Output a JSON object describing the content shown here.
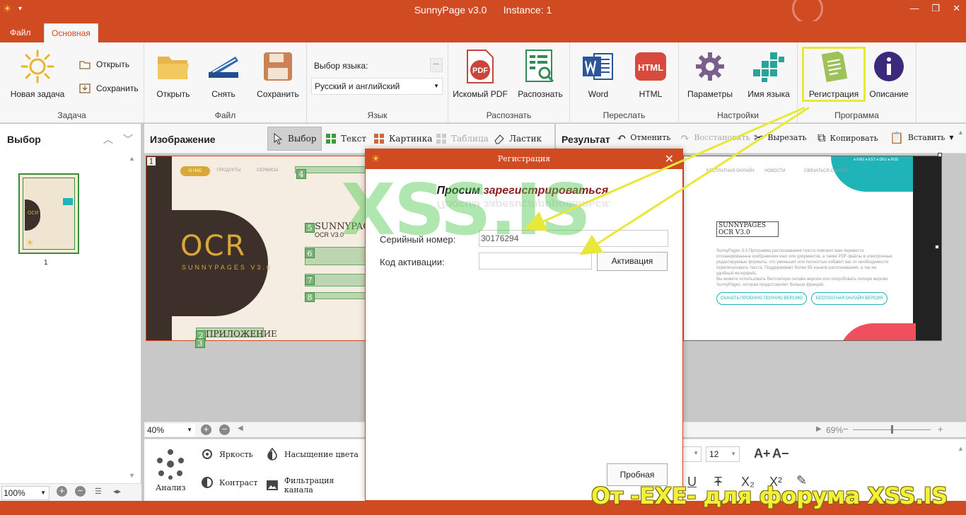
{
  "window": {
    "title": "SunnyPage v3.0      Instance: 1",
    "minimize": "—",
    "maximize": "❐",
    "close": "✕"
  },
  "tabs": {
    "file": "Файл",
    "main": "Основная"
  },
  "ribbon": {
    "task": {
      "new_task": "Новая задача",
      "open": "Открыть",
      "save": "Сохранить",
      "label": "Задача"
    },
    "file": {
      "open": "Открыть",
      "scan": "Снять",
      "save": "Сохранить",
      "label": "Файл"
    },
    "language": {
      "select_label": "Выбор языка:",
      "selected": "Русский и английский",
      "dots": "...",
      "label": "Язык"
    },
    "recognize": {
      "pdf": "Искомый PDF",
      "recognize": "Распознать",
      "label": "Распознать",
      "pdf_icon_text": "PDF"
    },
    "send": {
      "word": "Word",
      "html": "HTML",
      "label": "Переслать",
      "html_icon_text": "HTML"
    },
    "settings": {
      "params": "Параметры",
      "lang_name": "Имя языка",
      "label": "Настройки"
    },
    "program": {
      "register": "Регистрация",
      "about": "Описание",
      "label": "Программа"
    }
  },
  "left_panel": {
    "title": "Выбор",
    "page_number": "1",
    "zoom": "100%"
  },
  "image_panel": {
    "title": "Изображение",
    "tools": {
      "select": "Выбор",
      "text": "Текст",
      "picture": "Картинка",
      "table": "Таблица",
      "eraser": "Ластик"
    },
    "zoom": "40%",
    "page": {
      "nav": [
        "О НАС",
        "ПРОДУКТЫ",
        "СЕРВИСЫ"
      ],
      "ocr": "OCR",
      "ocr_sub": "SUNNYPAGES V3.0",
      "sunny_head": "SUNNYPAGES",
      "ocr_version": "OCR V3.0",
      "app_label": "ПРИЛОЖЕНИЕ",
      "box_numbers": [
        "1",
        "2",
        "3",
        "4",
        "5",
        "6",
        "7",
        "8"
      ]
    }
  },
  "filters": {
    "analysis": "Анализ",
    "brightness": "Яркость",
    "contrast": "Контраст",
    "saturation": "Насыщение цвета",
    "channel_filter": "Фильтрация канала"
  },
  "result_panel": {
    "title": "Результат",
    "tools": {
      "undo": "Отменить",
      "redo": "Восстановить",
      "cut": "Вырезать",
      "copy": "Копировать",
      "paste": "Вставить"
    },
    "zoom": "69%",
    "font_size": "12",
    "page": {
      "nav": [
        "БЕСПЛАТНАЯ ОНЛАЙН",
        "НОВОСТИ",
        "СВЯЗАТЬСЯ С НАМИ"
      ],
      "lang_switch": "● ENG ● EST ● DEU ● RUS",
      "heading_line1": "SUNNYPAGES",
      "heading_line2": "OCR V3.0",
      "paragraph1": "SunnyPages 3.0 Программа распознавания текста поможет вам перевести отсканированные изображения книг или документов, а также PDF-файлы в электронные редактируемые форматы, что уменьшит или полностью избавит вас от необходимости перепечатывать текста. Поддерживает более 95 языков распознавания, а так же удобный интерфейс.",
      "paragraph2": "Вы можете использовать бесплатную онлайн версию или попробовать полную версию SunnyPages, которая предоставляет больше функций.",
      "btn_trial": "СКАЧАТЬ ПРОБНУЮ ПОЛНУЮ ВЕРСИЮ",
      "btn_online": "БЕСПЛАТНАЯ ОНЛАЙН ВЕРСИЯ"
    }
  },
  "dialog": {
    "title": "Регистрация",
    "close": "✕",
    "heading_word1": "Просим",
    "heading_word2": "зарегистрироваться.",
    "serial_label": "Серийный номер:",
    "serial_value": "30176294",
    "activation_label": "Код активации:",
    "activation_value": "",
    "activate_button": "Активация",
    "trial_button": "Пробная"
  },
  "overlay": {
    "watermark": "XSS.IS",
    "forum_text": "От -EXE- для форума XSS.IS"
  },
  "colors": {
    "brand": "#d04a22",
    "highlight": "#e8e83a",
    "watermark": "#50c850"
  }
}
